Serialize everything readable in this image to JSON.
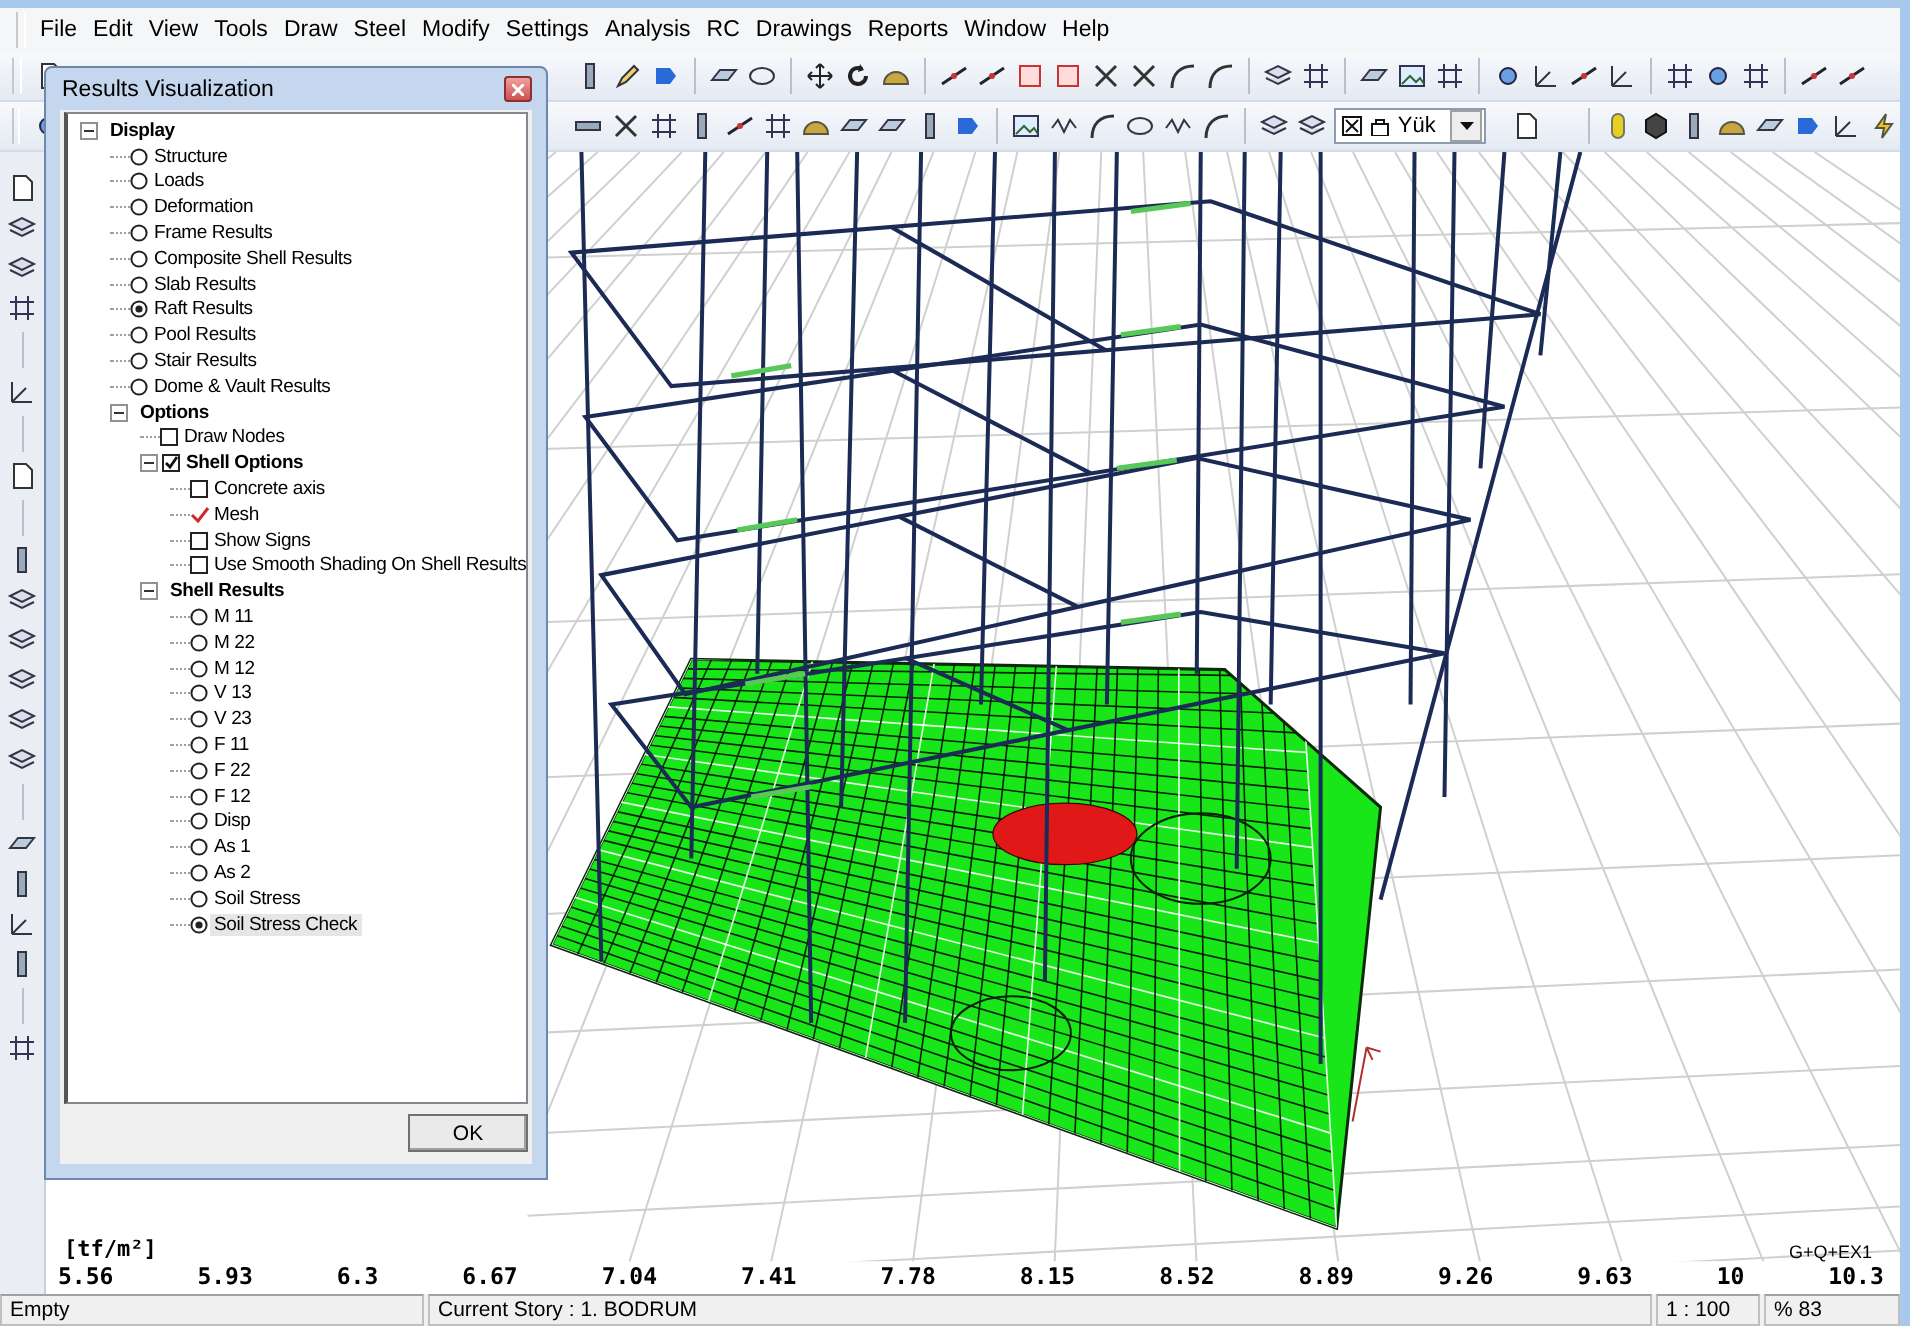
{
  "menu": [
    "File",
    "Edit",
    "View",
    "Tools",
    "Draw",
    "Steel",
    "Modify",
    "Settings",
    "Analysis",
    "RC",
    "Drawings",
    "Reports",
    "Window",
    "Help"
  ],
  "toolbar": {
    "load_combo": {
      "value": "Yük"
    }
  },
  "dialog": {
    "title": "Results Visualization",
    "ok_button": "OK",
    "tree": [
      {
        "label": "Display",
        "kind": "group",
        "expanded": true,
        "children": [
          {
            "label": "Structure",
            "kind": "radio",
            "selected": false
          },
          {
            "label": "Loads",
            "kind": "radio",
            "selected": false
          },
          {
            "label": "Deformation",
            "kind": "radio",
            "selected": false
          },
          {
            "label": "Frame Results",
            "kind": "radio",
            "selected": false
          },
          {
            "label": "Composite Shell Results",
            "kind": "radio",
            "selected": false
          },
          {
            "label": "Slab Results",
            "kind": "radio",
            "selected": false
          },
          {
            "label": "Raft Results",
            "kind": "radio",
            "selected": true
          },
          {
            "label": "Pool Results",
            "kind": "radio",
            "selected": false
          },
          {
            "label": "Stair Results",
            "kind": "radio",
            "selected": false
          },
          {
            "label": "Dome & Vault Results",
            "kind": "radio",
            "selected": false
          },
          {
            "label": "Options",
            "kind": "group",
            "expanded": true,
            "children": [
              {
                "label": "Draw Nodes",
                "kind": "checkbox",
                "checked": false
              },
              {
                "label": "Shell Options",
                "kind": "checkbox",
                "checked": true,
                "expanded": true,
                "children": [
                  {
                    "label": "Concrete axis",
                    "kind": "checkbox",
                    "checked": false
                  },
                  {
                    "label": "Mesh",
                    "kind": "check_mark",
                    "checked": true
                  },
                  {
                    "label": "Show Signs",
                    "kind": "checkbox",
                    "checked": false
                  },
                  {
                    "label": "Use Smooth Shading On Shell Results",
                    "kind": "checkbox",
                    "checked": false
                  }
                ]
              },
              {
                "label": "Shell Results",
                "kind": "group",
                "expanded": true,
                "children": [
                  {
                    "label": "M 11",
                    "kind": "radio",
                    "selected": false,
                    "focused": false
                  },
                  {
                    "label": "M 22",
                    "kind": "radio",
                    "selected": false,
                    "focused": false
                  },
                  {
                    "label": "M 12",
                    "kind": "radio",
                    "selected": false,
                    "focused": false
                  },
                  {
                    "label": "V 13",
                    "kind": "radio",
                    "selected": false,
                    "focused": false
                  },
                  {
                    "label": "V 23",
                    "kind": "radio",
                    "selected": false,
                    "focused": false
                  },
                  {
                    "label": "F 11",
                    "kind": "radio",
                    "selected": false,
                    "focused": false
                  },
                  {
                    "label": "F 22",
                    "kind": "radio",
                    "selected": false,
                    "focused": false
                  },
                  {
                    "label": "F 12",
                    "kind": "radio",
                    "selected": false,
                    "focused": false
                  },
                  {
                    "label": "Disp",
                    "kind": "radio",
                    "selected": false,
                    "focused": false
                  },
                  {
                    "label": "As 1",
                    "kind": "radio",
                    "selected": false,
                    "focused": false
                  },
                  {
                    "label": "As 2",
                    "kind": "radio",
                    "selected": false,
                    "focused": false
                  },
                  {
                    "label": "Soil Stress",
                    "kind": "radio",
                    "selected": false,
                    "focused": false
                  },
                  {
                    "label": "Soil Stress Check",
                    "kind": "radio",
                    "selected": true,
                    "focused": true
                  }
                ]
              }
            ]
          }
        ]
      }
    ]
  },
  "legend": {
    "unit": "[tf/m²]",
    "values": [
      "5.56",
      "5.93",
      "6.3",
      "6.67",
      "7.04",
      "7.41",
      "7.78",
      "8.15",
      "8.52",
      "8.89",
      "9.26",
      "9.63",
      "10",
      "10.3"
    ],
    "load_case": "G+Q+EX1"
  },
  "status_bar": [
    "Empty",
    "Current Story : 1. BODRUM",
    "1 : 100",
    "% 83"
  ]
}
